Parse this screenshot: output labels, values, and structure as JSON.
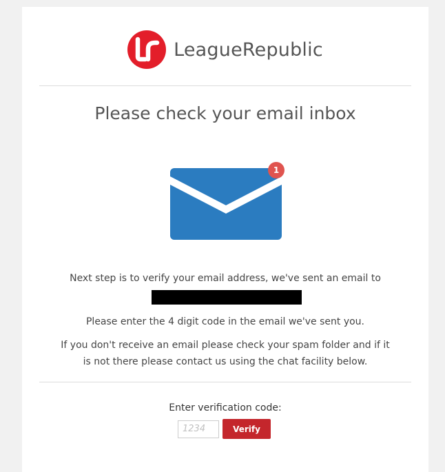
{
  "brand": {
    "name": "LeagueRepublic",
    "logo_initials": "LR",
    "logo_color": "#e31e2a"
  },
  "page": {
    "title": "Please check your email inbox"
  },
  "mail_icon": {
    "icon": "envelope-icon",
    "color": "#2b7cc0",
    "badge_count": "1",
    "badge_color": "#e0544f"
  },
  "message": {
    "line1": "Next step is to verify your email address, we've sent an email to",
    "email_redacted": "",
    "line2": "Please enter the 4 digit code in the email we've sent you.",
    "line3a": "If you don't receive an email please check your spam folder and if it",
    "line3b": "is not there please contact us using the chat facility below."
  },
  "verification": {
    "label": "Enter verification code:",
    "input_value": "",
    "input_placeholder": "1234",
    "button_label": "Verify",
    "button_color": "#c4262c"
  }
}
